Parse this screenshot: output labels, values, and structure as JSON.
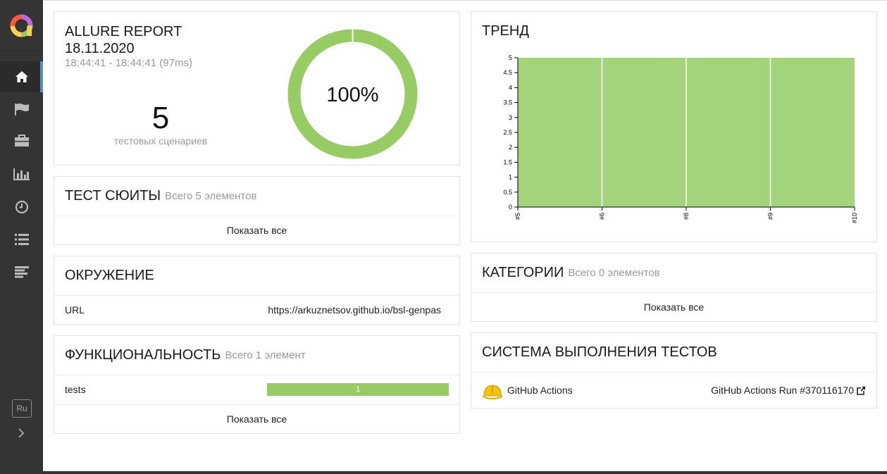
{
  "sidebar": {
    "items": [
      {
        "icon": "home-icon",
        "label": "Overview"
      },
      {
        "icon": "flag-icon",
        "label": "Categories"
      },
      {
        "icon": "briefcase-icon",
        "label": "Suites"
      },
      {
        "icon": "bar-chart-icon",
        "label": "Graphs"
      },
      {
        "icon": "clock-icon",
        "label": "Timeline"
      },
      {
        "icon": "list-icon",
        "label": "Behaviors"
      },
      {
        "icon": "align-left-icon",
        "label": "Packages"
      }
    ],
    "language": "Ru"
  },
  "summary": {
    "title": "ALLURE REPORT",
    "date": "18.11.2020",
    "time_range": "18:44:41 - 18:44:41 (97ms)",
    "test_count": "5",
    "test_count_label": "тестовых сценариев",
    "percent": "100%",
    "pass_fraction": 1.0,
    "pass_color": "#97cc64"
  },
  "suites": {
    "title": "ТЕСТ СЮИТЫ",
    "count": "Всего 5 элементов",
    "show_all": "Показать все"
  },
  "environment": {
    "title": "ОКРУЖЕНИЕ",
    "rows": [
      {
        "key": "URL",
        "value": "https://arkuznetsov.github.io/bsl-genpas"
      }
    ]
  },
  "features": {
    "title": "ФУНКЦИОНАЛЬНОСТЬ",
    "count": "Всего 1 элемент",
    "rows": [
      {
        "name": "tests",
        "passed": "1",
        "fraction": 1.0
      }
    ],
    "show_all": "Показать все"
  },
  "trend": {
    "title": "ТРЕНД"
  },
  "categories": {
    "title": "КАТЕГОРИИ",
    "count": "Всего 0 элементов",
    "show_all": "Показать все"
  },
  "executors": {
    "title": "СИСТЕМА ВЫПОЛНЕНИЯ ТЕСТОВ",
    "name": "GitHub Actions",
    "run": "GitHub Actions Run #370116170"
  },
  "chart_data": {
    "type": "area",
    "categories": [
      "#5",
      "#6",
      "#8",
      "#9",
      "#10"
    ],
    "series": [
      {
        "values": [
          5,
          5,
          5,
          5,
          5
        ],
        "color": "#a3d47c"
      }
    ],
    "yticks": [
      "0",
      "0.5",
      "1",
      "1.5",
      "2",
      "2.5",
      "3",
      "3.5",
      "4",
      "4.5",
      "5"
    ],
    "ylim": [
      0,
      5
    ]
  }
}
